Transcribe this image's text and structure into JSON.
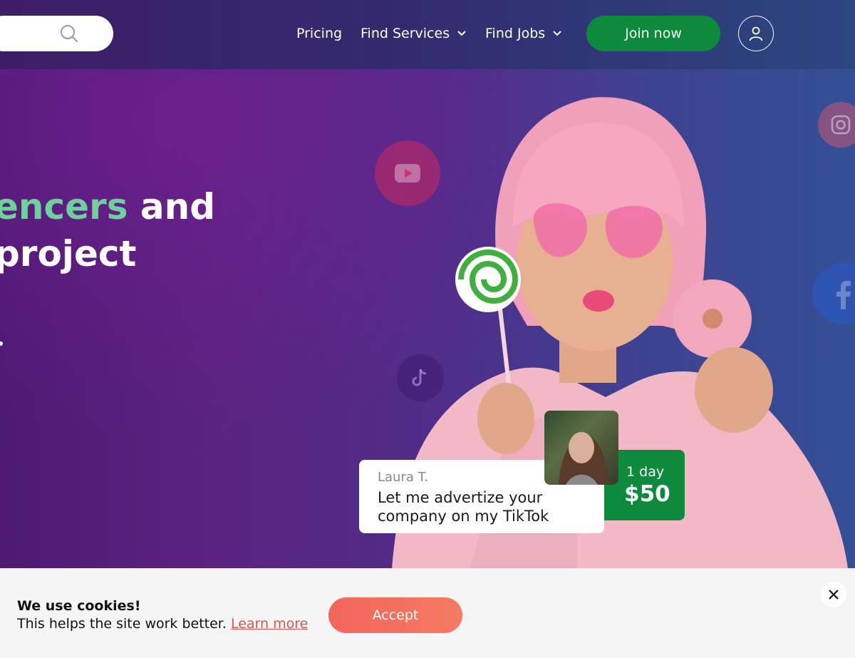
{
  "header": {
    "nav": {
      "pricing": "Pricing",
      "find_services": "Find Services",
      "find_jobs": "Find Jobs"
    },
    "join_label": "Join now"
  },
  "hero": {
    "headline_accent": "encers",
    "headline_line1_rest": " and",
    "headline_line2": "project"
  },
  "card": {
    "name": "Laura T.",
    "message": "Let me advertize your company on my TikTok",
    "duration": "1 day",
    "price": "$50"
  },
  "cookie": {
    "title": "We use cookies!",
    "text": "This helps the site work better.",
    "link": "Learn more",
    "accept_label": "Accept"
  },
  "colors": {
    "accent_green": "#0d8a3c",
    "headline_accent": "#6fd19a",
    "cookie_button": "#f4655a"
  }
}
